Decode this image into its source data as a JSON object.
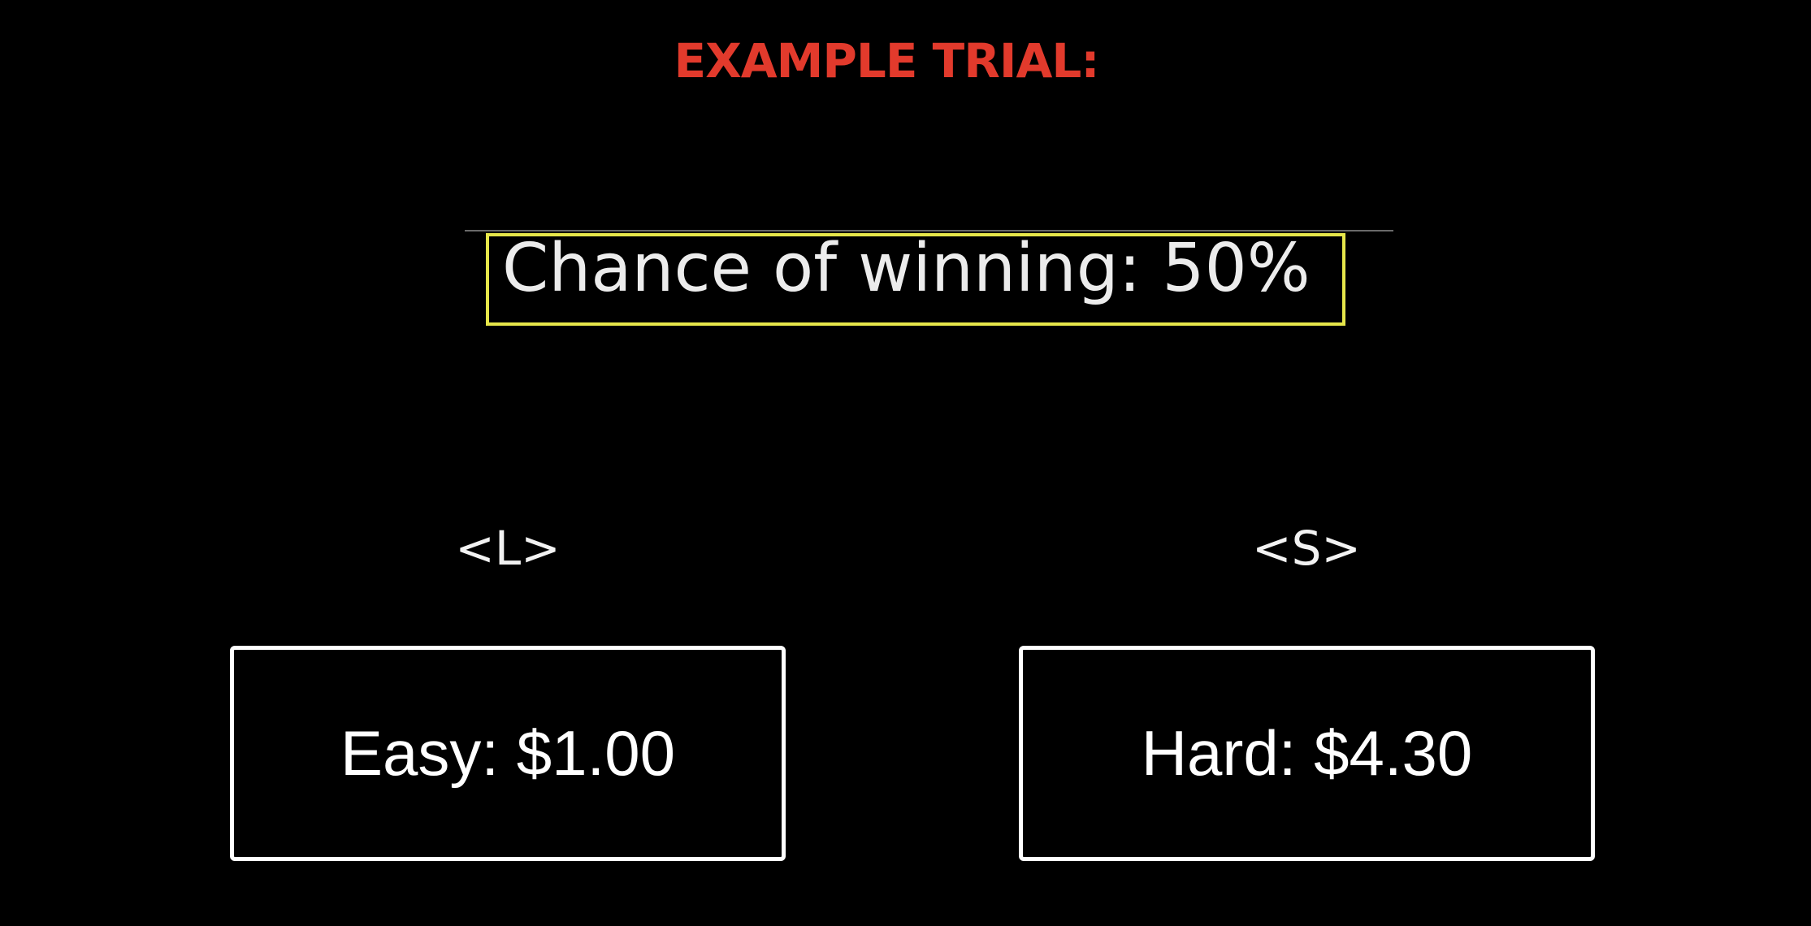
{
  "header": {
    "title": "EXAMPLE TRIAL:"
  },
  "trial": {
    "chance_text": "Chance of winning: 50%"
  },
  "options": {
    "left": {
      "key": "<L>",
      "label": "Easy: $1.00"
    },
    "right": {
      "key": "<S>",
      "label": "Hard: $4.30"
    }
  },
  "colors": {
    "background": "#000000",
    "title": "#e23a2c",
    "highlight_border": "#e6e64a",
    "text": "#ffffff"
  }
}
